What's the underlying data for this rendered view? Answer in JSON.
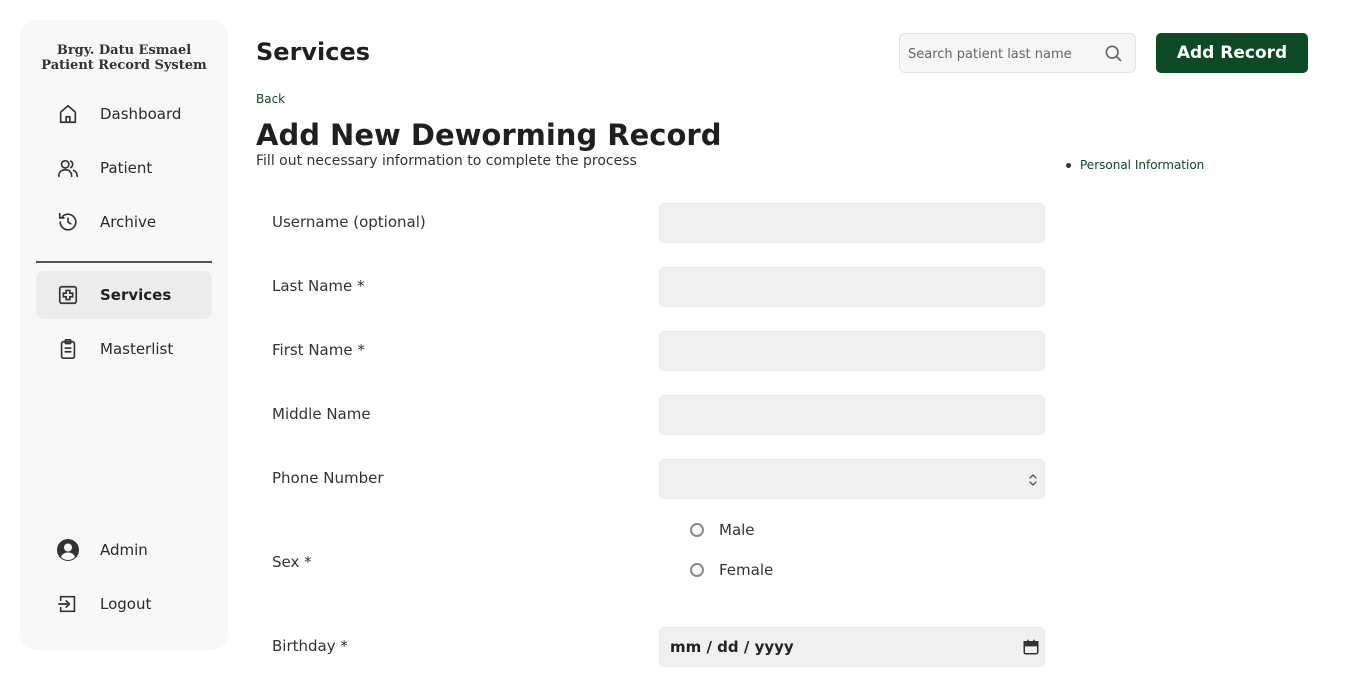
{
  "sidebar": {
    "brand_line1": "Brgy. Datu Esmael",
    "brand_line2": "Patient Record System",
    "items": [
      {
        "label": "Dashboard",
        "icon": "home-icon"
      },
      {
        "label": "Patient",
        "icon": "users-icon"
      },
      {
        "label": "Archive",
        "icon": "history-icon"
      },
      {
        "label": "Services",
        "icon": "medical-plus-icon",
        "active": true
      },
      {
        "label": "Masterlist",
        "icon": "clipboard-icon"
      }
    ],
    "bottom_items": [
      {
        "label": "Admin",
        "icon": "user-circle-icon"
      },
      {
        "label": "Logout",
        "icon": "logout-icon"
      }
    ]
  },
  "header": {
    "title": "Services",
    "search_placeholder": "Search patient last name",
    "add_button": "Add Record"
  },
  "form": {
    "back": "Back",
    "title": "Add New Deworming Record",
    "subtitle": "Fill out necessary information to complete the process",
    "side_link": "Personal Information",
    "fields": {
      "username": "Username (optional)",
      "last_name": "Last Name *",
      "first_name": "First Name *",
      "middle_name": "Middle Name",
      "phone": "Phone Number",
      "sex": "Sex *",
      "birthday": "Birthday *"
    },
    "sex_options": [
      "Male",
      "Female"
    ],
    "birthday_placeholder": "mm / dd / yyyy"
  },
  "colors": {
    "accent": "#0b4a25",
    "sidebar_bg": "#f8f8f8",
    "input_bg": "#f0f0f0"
  }
}
